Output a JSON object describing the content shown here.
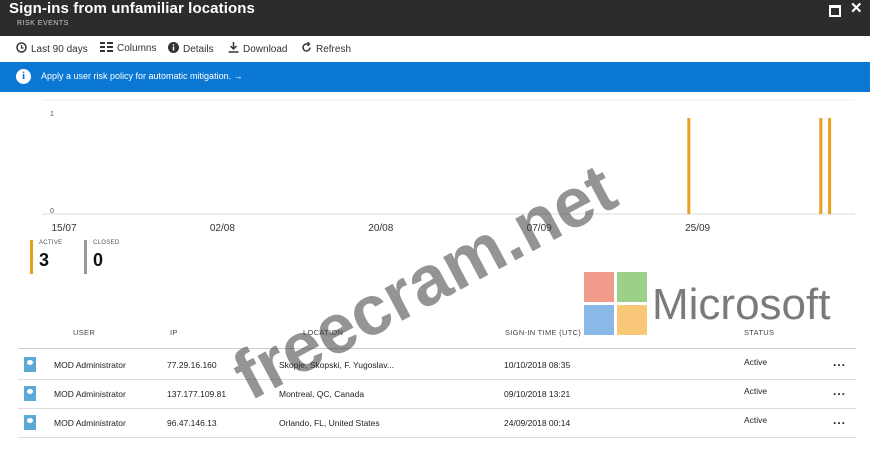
{
  "header": {
    "title": "Sign-ins from unfamiliar locations",
    "subtitle": "RISK EVENTS"
  },
  "toolbar": {
    "items": [
      {
        "label": "Last 90 days",
        "icon": "clock-icon"
      },
      {
        "label": "Columns",
        "icon": "columns-icon"
      },
      {
        "label": "Details",
        "icon": "info-icon"
      },
      {
        "label": "Download",
        "icon": "download-icon"
      },
      {
        "label": "Refresh",
        "icon": "refresh-icon"
      }
    ]
  },
  "banner": {
    "text": "Apply a user risk policy for automatic mitigation. →",
    "color": "#0a78d4"
  },
  "chart_data": {
    "type": "bar",
    "y_ticks": [
      "1",
      "0"
    ],
    "ylim": [
      0,
      1
    ],
    "x_tick_labels": [
      "15/07",
      "02/08",
      "20/08",
      "07/09",
      "25/09"
    ],
    "bar_color": "#e8a020",
    "events": [
      {
        "date": "24/09",
        "value": 1
      },
      {
        "date": "09/10",
        "value": 1
      },
      {
        "date": "10/10",
        "value": 1
      }
    ]
  },
  "counters": {
    "active": {
      "label": "ACTIVE",
      "value": "3",
      "color": "#e8a020"
    },
    "closed": {
      "label": "CLOSED",
      "value": "0",
      "color": "#999999"
    }
  },
  "table": {
    "columns": [
      "USER",
      "IP",
      "LOCATION",
      "SIGN-IN TIME (UTC)",
      "STATUS"
    ],
    "rows": [
      {
        "user": "MOD Administrator",
        "ip": "77.29.16.160",
        "location": "Skopje, Skopski, F. Yugoslav...",
        "time": "10/10/2018 08:35",
        "status": "Active"
      },
      {
        "user": "MOD Administrator",
        "ip": "137.177.109.81",
        "location": "Montreal, QC, Canada",
        "time": "09/10/2018 13:21",
        "status": "Active"
      },
      {
        "user": "MOD Administrator",
        "ip": "96.47.146.13",
        "location": "Orlando, FL, United States",
        "time": "24/09/2018 00:14",
        "status": "Active"
      }
    ],
    "more_label": "..."
  },
  "overlays": {
    "watermark": "freecram.net",
    "logo_text": "Microsoft"
  }
}
